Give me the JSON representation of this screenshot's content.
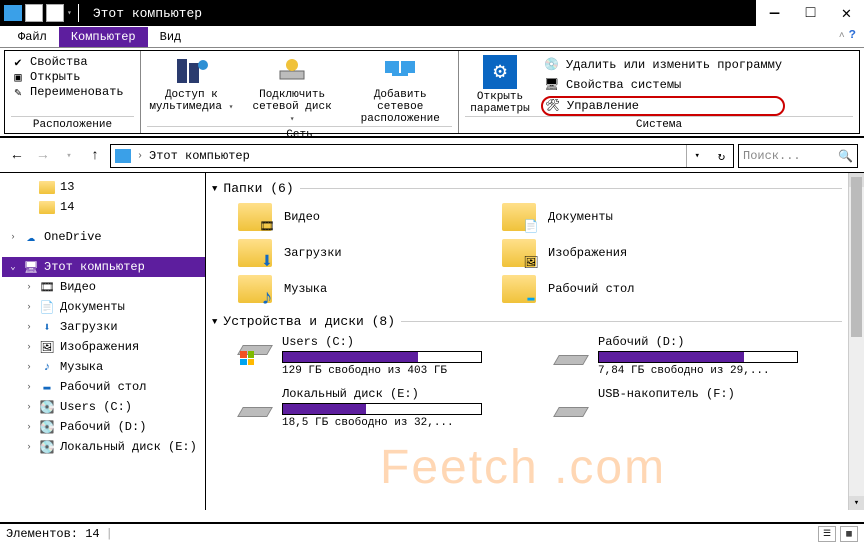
{
  "window": {
    "title": "Этот компьютер",
    "min": "—",
    "max": "□",
    "close": "✕"
  },
  "tabs": {
    "file": "Файл",
    "computer": "Компьютер",
    "view": "Вид"
  },
  "ribbon": {
    "location": {
      "label": "Расположение",
      "properties": "Свойства",
      "open": "Открыть",
      "rename": "Переименовать"
    },
    "network": {
      "label": "Сеть",
      "multimedia": "Доступ к\nмультимедиа",
      "mapdrive": "Подключить\nсетевой диск",
      "addloc": "Добавить сетевое\nрасположение"
    },
    "system": {
      "label": "Система",
      "openparams": "Открыть\nпараметры",
      "uninstall": "Удалить или изменить программу",
      "sysprops": "Свойства системы",
      "manage": "Управление"
    }
  },
  "address": {
    "path": "Этот компьютер",
    "search_placeholder": "Поиск..."
  },
  "tree": {
    "quick": [
      {
        "label": "13"
      },
      {
        "label": "14"
      }
    ],
    "onedrive": "OneDrive",
    "thispc": "Этот компьютер",
    "children": [
      {
        "label": "Видео"
      },
      {
        "label": "Документы"
      },
      {
        "label": "Загрузки"
      },
      {
        "label": "Изображения"
      },
      {
        "label": "Музыка"
      },
      {
        "label": "Рабочий стол"
      },
      {
        "label": "Users (C:)"
      },
      {
        "label": "Рабочий (D:)"
      },
      {
        "label": "Локальный диск (E:)"
      }
    ]
  },
  "content": {
    "folders_header": "Папки (6)",
    "folders": [
      {
        "name": "Видео"
      },
      {
        "name": "Документы"
      },
      {
        "name": "Загрузки"
      },
      {
        "name": "Изображения"
      },
      {
        "name": "Музыка"
      },
      {
        "name": "Рабочий стол"
      }
    ],
    "drives_header": "Устройства и диски (8)",
    "drives": [
      {
        "name": "Users (C:)",
        "info": "129 ГБ свободно из 403 ГБ",
        "fill": 68
      },
      {
        "name": "Рабочий (D:)",
        "info": "7,84 ГБ свободно из 29,...",
        "fill": 73
      },
      {
        "name": "Локальный диск (E:)",
        "info": "18,5 ГБ свободно из 32,...",
        "fill": 42
      },
      {
        "name": "USB-накопитель (F:)",
        "info": "",
        "fill": 0
      }
    ]
  },
  "status": {
    "items": "Элементов: 14"
  },
  "watermark": "Feetch .com"
}
